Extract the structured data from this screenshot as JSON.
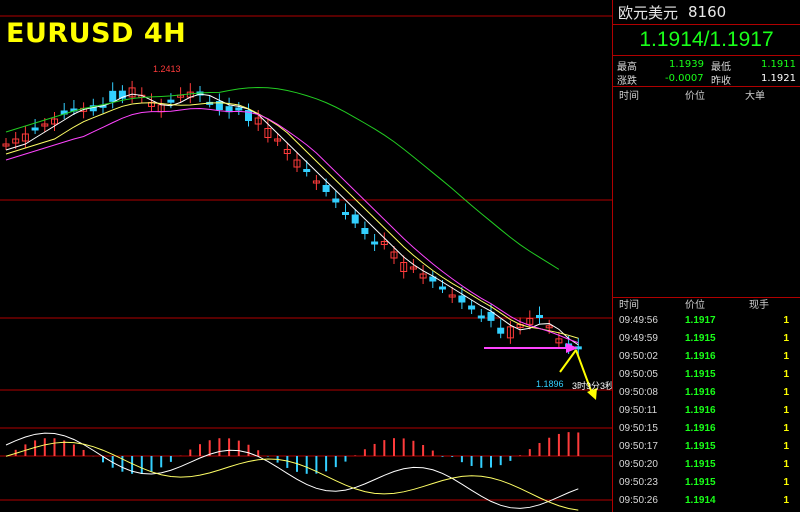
{
  "chart": {
    "title": "EURUSD 4H",
    "high_label": "1.2413",
    "low_label": "1.1896",
    "countdown": "3时9分3秒"
  },
  "colors": {
    "bull": "#ff3b3b",
    "bear": "#33d0ff",
    "ma_fast": "#ffffff",
    "ma_mid": "#ffff66",
    "ma_slow": "#ff44ff",
    "ma_long": "#22cc22",
    "divider": "#b00000",
    "price_green": "#19ff19",
    "volume_yellow": "#ffff00"
  },
  "panel": {
    "symbol_name": "欧元美元",
    "symbol_code": "8160",
    "quote": "1.1914/1.1917",
    "stats": {
      "high_label": "最高",
      "high_value": "1.1939",
      "low_label": "最低",
      "low_value": "1.1911",
      "change_label": "涨跌",
      "change_value": "-0.0007",
      "prev_close_label": "昨收",
      "prev_close_value": "1.1921"
    },
    "big_orders_header": {
      "time": "时间",
      "price": "价位",
      "size": "大单"
    },
    "ticks_header": {
      "time": "时间",
      "price": "价位",
      "volume": "现手"
    },
    "ticks": [
      {
        "time": "09:49:56",
        "price": "1.1917",
        "volume": "1"
      },
      {
        "time": "09:49:59",
        "price": "1.1915",
        "volume": "1"
      },
      {
        "time": "09:50:02",
        "price": "1.1916",
        "volume": "1"
      },
      {
        "time": "09:50:05",
        "price": "1.1915",
        "volume": "1"
      },
      {
        "time": "09:50:08",
        "price": "1.1916",
        "volume": "1"
      },
      {
        "time": "09:50:11",
        "price": "1.1916",
        "volume": "1"
      },
      {
        "time": "09:50:15",
        "price": "1.1916",
        "volume": "1"
      },
      {
        "time": "09:50:17",
        "price": "1.1915",
        "volume": "1"
      },
      {
        "time": "09:50:20",
        "price": "1.1915",
        "volume": "1"
      },
      {
        "time": "09:50:23",
        "price": "1.1915",
        "volume": "1"
      },
      {
        "time": "09:50:26",
        "price": "1.1914",
        "volume": "1"
      }
    ]
  }
}
